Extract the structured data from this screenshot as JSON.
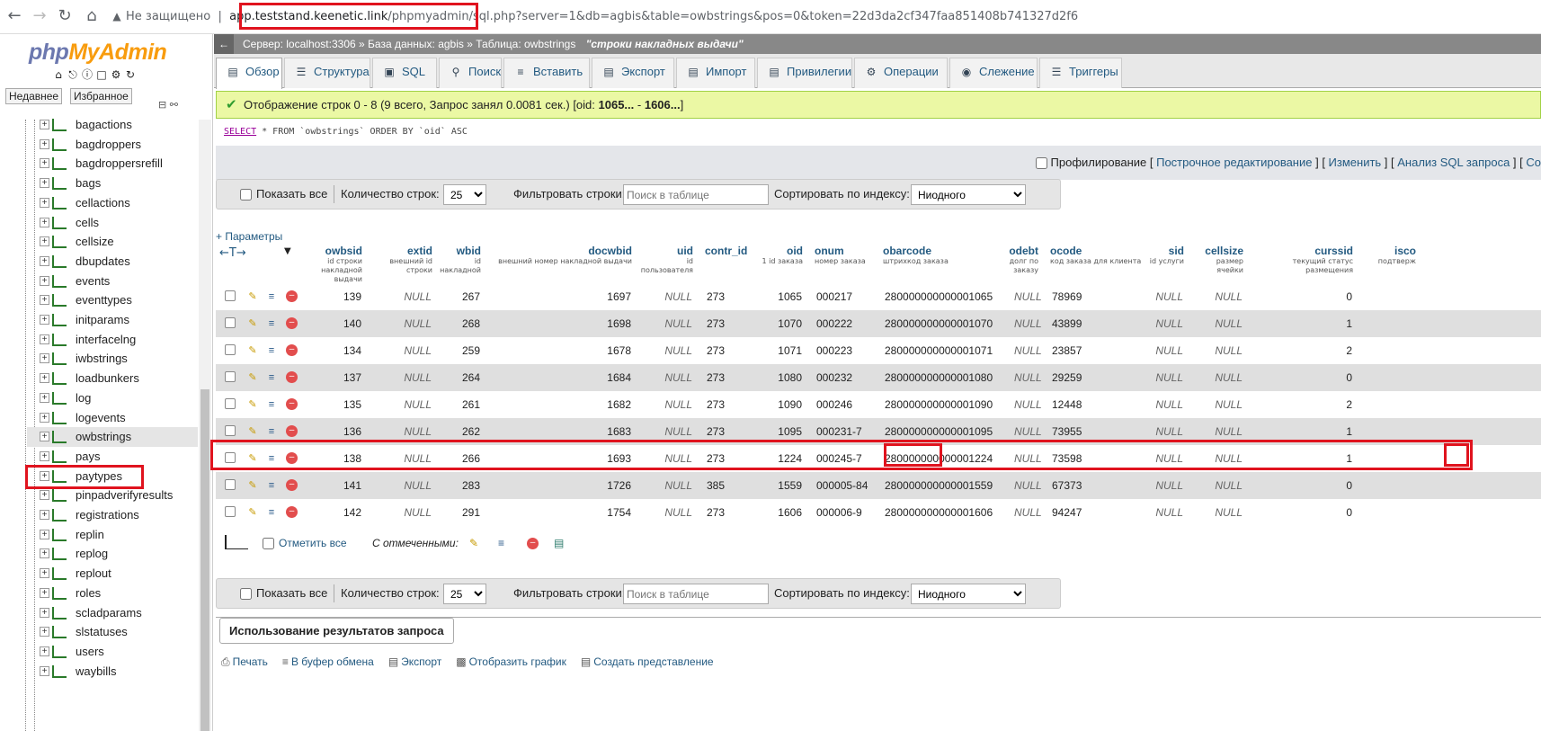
{
  "browser": {
    "insecure": "Не защищено",
    "host": "app.teststand.keenetic.link",
    "path": "/phpmyadmin/",
    "query": "sql.php?server=1&db=agbis&table=owbstrings&pos=0&token=22d3da2cf347faa851408b741327d2f6"
  },
  "logo": {
    "php": "php",
    "mya": "MyAdmin"
  },
  "navtabs": [
    "Недавнее",
    "Избранное"
  ],
  "tree": [
    "bagactions",
    "bagdroppers",
    "bagdroppersrefill",
    "bags",
    "cellactions",
    "cells",
    "cellsize",
    "dbupdates",
    "events",
    "eventtypes",
    "initparams",
    "interfacelng",
    "iwbstrings",
    "loadbunkers",
    "log",
    "logevents",
    "owbstrings",
    "pays",
    "paytypes",
    "pinpadverifyresults",
    "registrations",
    "replin",
    "replog",
    "replout",
    "roles",
    "scladparams",
    "slstatuses",
    "users",
    "waybills"
  ],
  "crumb": {
    "server": "Сервер: localhost:3306",
    "sep": "»",
    "db": "База данных: agbis",
    "table": "Таблица: owbstrings",
    "comment": "\"строки накладных выдачи\""
  },
  "tabs": [
    "Обзор",
    "Структура",
    "SQL",
    "Поиск",
    "Вставить",
    "Экспорт",
    "Импорт",
    "Привилегии",
    "Операции",
    "Слежение",
    "Триггеры"
  ],
  "success": {
    "text": "Отображение строк 0 - 8 (9 всего, Запрос занял 0.0081 сек.) [oid: ",
    "b1": "1065...",
    "dash": " - ",
    "b2": "1606...",
    "end": "]"
  },
  "sql": {
    "kw": "SELECT",
    "rest": " * FROM `owbstrings` ORDER BY `oid` ASC"
  },
  "profbar": {
    "profile": "Профилирование",
    "l1": "Построчное редактирование",
    "l2": "Изменить",
    "l3": "Анализ SQL запроса",
    "l4": "Co"
  },
  "navbar": {
    "showall": "Показать все",
    "rows_label": "Количество строк:",
    "rows_val": "25",
    "filter_label": "Фильтровать строки:",
    "filter_ph": "Поиск в таблице",
    "sort_label": "Сортировать по индексу:",
    "sort_val": "Ниодного"
  },
  "params": "+ Параметры",
  "columns": [
    {
      "name": "owbsid",
      "comment": "id строки накладной выдачи"
    },
    {
      "name": "extid",
      "comment": "внешний id строки"
    },
    {
      "name": "wbid",
      "comment": "id накладной"
    },
    {
      "name": "docwbid",
      "comment": "внешний номер накладной выдачи"
    },
    {
      "name": "uid",
      "comment": "id пользователя"
    },
    {
      "name": "contr_id",
      "comment": ""
    },
    {
      "name": "oid",
      "comment": "1 id заказа"
    },
    {
      "name": "onum",
      "comment": "номер заказа"
    },
    {
      "name": "obarcode",
      "comment": "штрихкод заказа"
    },
    {
      "name": "odebt",
      "comment": "долг по заказу"
    },
    {
      "name": "ocode",
      "comment": "код заказа для клиента"
    },
    {
      "name": "sid",
      "comment": "id услуги"
    },
    {
      "name": "cellsize",
      "comment": "размер ячейки"
    },
    {
      "name": "curssid",
      "comment": "текущий статус размещения"
    },
    {
      "name": "isco",
      "comment": "подтверж"
    }
  ],
  "rows": [
    [
      "139",
      "NULL",
      "267",
      "1697",
      "NULL",
      "273",
      "1065",
      "000217",
      "280000000000001065",
      "NULL",
      "78969",
      "NULL",
      "NULL",
      "0"
    ],
    [
      "140",
      "NULL",
      "268",
      "1698",
      "NULL",
      "273",
      "1070",
      "000222",
      "280000000000001070",
      "NULL",
      "43899",
      "NULL",
      "NULL",
      "1"
    ],
    [
      "134",
      "NULL",
      "259",
      "1678",
      "NULL",
      "273",
      "1071",
      "000223",
      "280000000000001071",
      "NULL",
      "23857",
      "NULL",
      "NULL",
      "2"
    ],
    [
      "137",
      "NULL",
      "264",
      "1684",
      "NULL",
      "273",
      "1080",
      "000232",
      "280000000000001080",
      "NULL",
      "29259",
      "NULL",
      "NULL",
      "0"
    ],
    [
      "135",
      "NULL",
      "261",
      "1682",
      "NULL",
      "273",
      "1090",
      "000246",
      "280000000000001090",
      "NULL",
      "12448",
      "NULL",
      "NULL",
      "2"
    ],
    [
      "136",
      "NULL",
      "262",
      "1683",
      "NULL",
      "273",
      "1095",
      "000231-7",
      "280000000000001095",
      "NULL",
      "73955",
      "NULL",
      "NULL",
      "1"
    ],
    [
      "138",
      "NULL",
      "266",
      "1693",
      "NULL",
      "273",
      "1224",
      "000245-7",
      "280000000000001224",
      "NULL",
      "73598",
      "NULL",
      "NULL",
      "1"
    ],
    [
      "141",
      "NULL",
      "283",
      "1726",
      "NULL",
      "385",
      "1559",
      "000005-84",
      "280000000000001559",
      "NULL",
      "67373",
      "NULL",
      "NULL",
      "0"
    ],
    [
      "142",
      "NULL",
      "291",
      "1754",
      "NULL",
      "273",
      "1606",
      "000006-9",
      "280000000000001606",
      "NULL",
      "94247",
      "NULL",
      "NULL",
      "0"
    ]
  ],
  "bulk": {
    "checkall": "Отметить все",
    "with": "С отмеченными:"
  },
  "usage": {
    "title": "Использование результатов запроса",
    "ops": [
      "Печать",
      "В буфер обмена",
      "Экспорт",
      "Отобразить график",
      "Создать представление"
    ]
  }
}
